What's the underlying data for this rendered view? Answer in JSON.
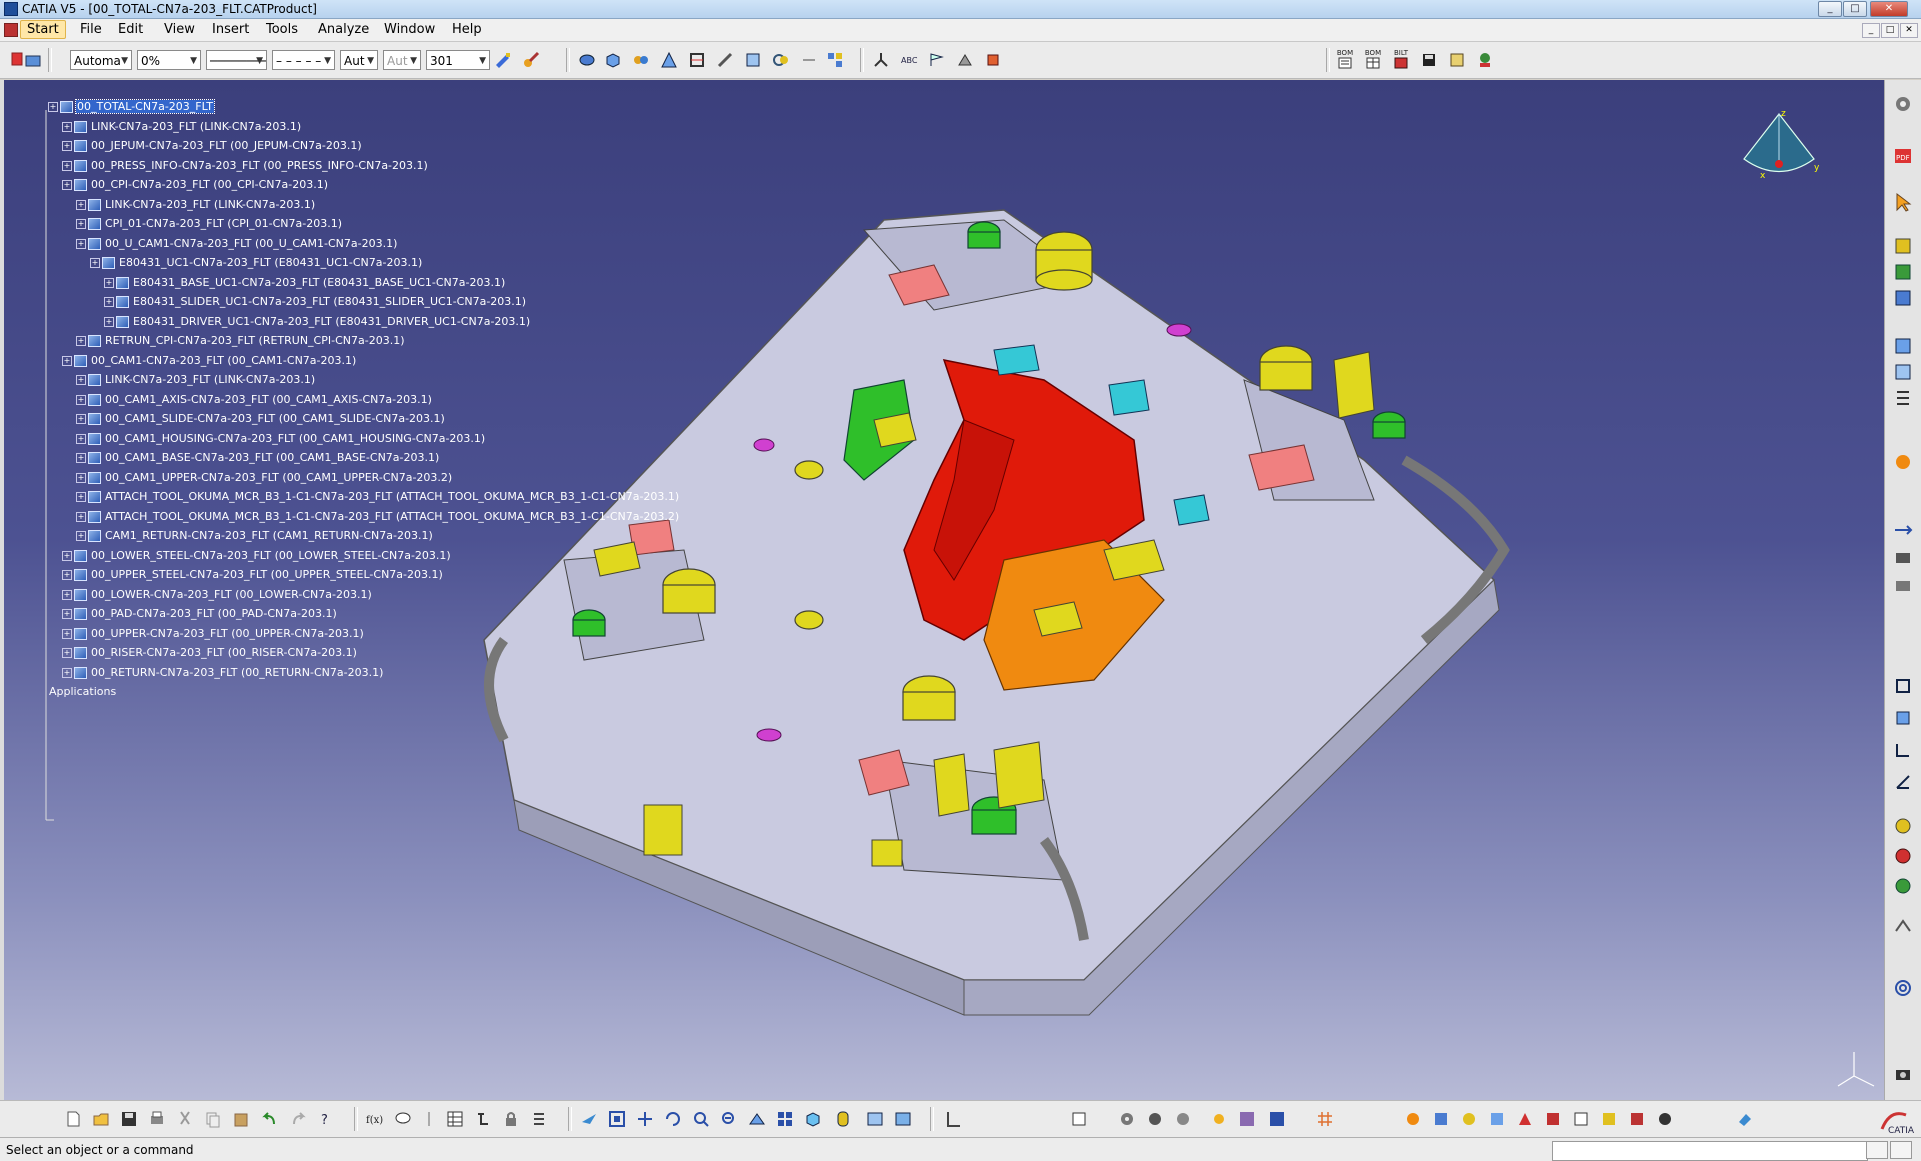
{
  "window": {
    "title": "CATIA V5 - [00_TOTAL-CN7a-203_FLT.CATProduct]",
    "controls": {
      "minimize": "_",
      "restore": "□",
      "close": "✕"
    }
  },
  "menubar": {
    "items": [
      "Start",
      "File",
      "Edit",
      "View",
      "Insert",
      "Tools",
      "Analyze",
      "Window",
      "Help"
    ]
  },
  "toolbar_top": {
    "combos": [
      {
        "value": "Automa",
        "enabled": true
      },
      {
        "value": "0%",
        "enabled": true
      },
      {
        "value": "────────",
        "enabled": true
      },
      {
        "value": "– – – – –",
        "enabled": true
      },
      {
        "value": "Aut",
        "enabled": true
      },
      {
        "value": "Aut",
        "enabled": false
      },
      {
        "value": "301",
        "enabled": true
      }
    ],
    "labels": {
      "bom1": "BOM",
      "bom2": "BOM",
      "bom3": "BILT"
    }
  },
  "tree": {
    "root": "00_TOTAL-CN7a-203_FLT",
    "nodes": [
      {
        "label": "LINK-CN7a-203_FLT (LINK-CN7a-203.1)",
        "level": 1
      },
      {
        "label": "00_JEPUM-CN7a-203_FLT (00_JEPUM-CN7a-203.1)",
        "level": 1
      },
      {
        "label": "00_PRESS_INFO-CN7a-203_FLT (00_PRESS_INFO-CN7a-203.1)",
        "level": 1
      },
      {
        "label": "00_CPI-CN7a-203_FLT (00_CPI-CN7a-203.1)",
        "level": 1
      },
      {
        "label": "LINK-CN7a-203_FLT (LINK-CN7a-203.1)",
        "level": 2
      },
      {
        "label": "CPI_01-CN7a-203_FLT (CPI_01-CN7a-203.1)",
        "level": 2
      },
      {
        "label": "00_U_CAM1-CN7a-203_FLT (00_U_CAM1-CN7a-203.1)",
        "level": 2
      },
      {
        "label": "E80431_UC1-CN7a-203_FLT (E80431_UC1-CN7a-203.1)",
        "level": 3
      },
      {
        "label": "E80431_BASE_UC1-CN7a-203_FLT (E80431_BASE_UC1-CN7a-203.1)",
        "level": 4
      },
      {
        "label": "E80431_SLIDER_UC1-CN7a-203_FLT (E80431_SLIDER_UC1-CN7a-203.1)",
        "level": 4
      },
      {
        "label": "E80431_DRIVER_UC1-CN7a-203_FLT (E80431_DRIVER_UC1-CN7a-203.1)",
        "level": 4
      },
      {
        "label": "RETRUN_CPI-CN7a-203_FLT (RETRUN_CPI-CN7a-203.1)",
        "level": 2
      },
      {
        "label": "00_CAM1-CN7a-203_FLT (00_CAM1-CN7a-203.1)",
        "level": 1
      },
      {
        "label": "LINK-CN7a-203_FLT (LINK-CN7a-203.1)",
        "level": 2
      },
      {
        "label": "00_CAM1_AXIS-CN7a-203_FLT (00_CAM1_AXIS-CN7a-203.1)",
        "level": 2
      },
      {
        "label": "00_CAM1_SLIDE-CN7a-203_FLT (00_CAM1_SLIDE-CN7a-203.1)",
        "level": 2
      },
      {
        "label": "00_CAM1_HOUSING-CN7a-203_FLT (00_CAM1_HOUSING-CN7a-203.1)",
        "level": 2
      },
      {
        "label": "00_CAM1_BASE-CN7a-203_FLT (00_CAM1_BASE-CN7a-203.1)",
        "level": 2
      },
      {
        "label": "00_CAM1_UPPER-CN7a-203_FLT (00_CAM1_UPPER-CN7a-203.2)",
        "level": 2
      },
      {
        "label": "ATTACH_TOOL_OKUMA_MCR_B3_1-C1-CN7a-203_FLT (ATTACH_TOOL_OKUMA_MCR_B3_1-C1-CN7a-203.1)",
        "level": 2
      },
      {
        "label": "ATTACH_TOOL_OKUMA_MCR_B3_1-C1-CN7a-203_FLT (ATTACH_TOOL_OKUMA_MCR_B3_1-C1-CN7a-203.2)",
        "level": 2
      },
      {
        "label": "CAM1_RETURN-CN7a-203_FLT (CAM1_RETURN-CN7a-203.1)",
        "level": 2
      },
      {
        "label": "00_LOWER_STEEL-CN7a-203_FLT (00_LOWER_STEEL-CN7a-203.1)",
        "level": 1
      },
      {
        "label": "00_UPPER_STEEL-CN7a-203_FLT (00_UPPER_STEEL-CN7a-203.1)",
        "level": 1
      },
      {
        "label": "00_LOWER-CN7a-203_FLT (00_LOWER-CN7a-203.1)",
        "level": 1
      },
      {
        "label": "00_PAD-CN7a-203_FLT (00_PAD-CN7a-203.1)",
        "level": 1
      },
      {
        "label": "00_UPPER-CN7a-203_FLT (00_UPPER-CN7a-203.1)",
        "level": 1
      },
      {
        "label": "00_RISER-CN7a-203_FLT (00_RISER-CN7a-203.1)",
        "level": 1
      },
      {
        "label": "00_RETURN-CN7a-203_FLT (00_RETURN-CN7a-203.1)",
        "level": 1
      }
    ],
    "footer": "Applications"
  },
  "compass": {
    "axes": [
      "x",
      "y",
      "z"
    ]
  },
  "status": {
    "message": "Select an object or a command",
    "command_input": ""
  },
  "colors": {
    "workspace_top": "#3b3f7c",
    "workspace_bottom": "#b7bad6",
    "die_body": "#c9cae0",
    "part_red": "#e01a0a",
    "part_yellow": "#e0d81e",
    "part_green": "#2fbf2a",
    "part_orange": "#f08a10",
    "part_cyan": "#35c8d6",
    "tree_selection": "#3366cc"
  }
}
